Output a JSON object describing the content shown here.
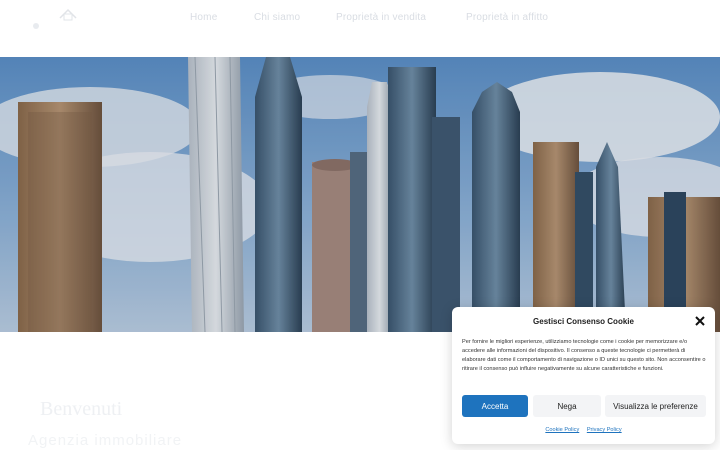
{
  "header": {
    "nav": [
      "Home",
      "Chi siamo",
      "Proprietà in vendita",
      "Proprietà in affitto"
    ]
  },
  "hero": {
    "alt": "Skyline"
  },
  "content": {
    "title": "Benvenuti",
    "subtitle": "Agenzia immobiliare"
  },
  "cookie": {
    "title": "Gestisci Consenso Cookie",
    "body": "Per fornire le migliori esperienze, utilizziamo tecnologie come i cookie per memorizzare e/o accedere alle informazioni del dispositivo. Il consenso a queste tecnologie ci permetterà di elaborare dati come il comportamento di navigazione o ID unici su questo sito. Non acconsentire o ritirare il consenso può influire negativamente su alcune caratteristiche e funzioni.",
    "accept": "Accetta",
    "deny": "Nega",
    "preferences": "Visualizza le preferenze",
    "cookie_policy": "Cookie Policy",
    "privacy_policy": "Privacy Policy"
  },
  "colors": {
    "accent": "#1e73be"
  }
}
